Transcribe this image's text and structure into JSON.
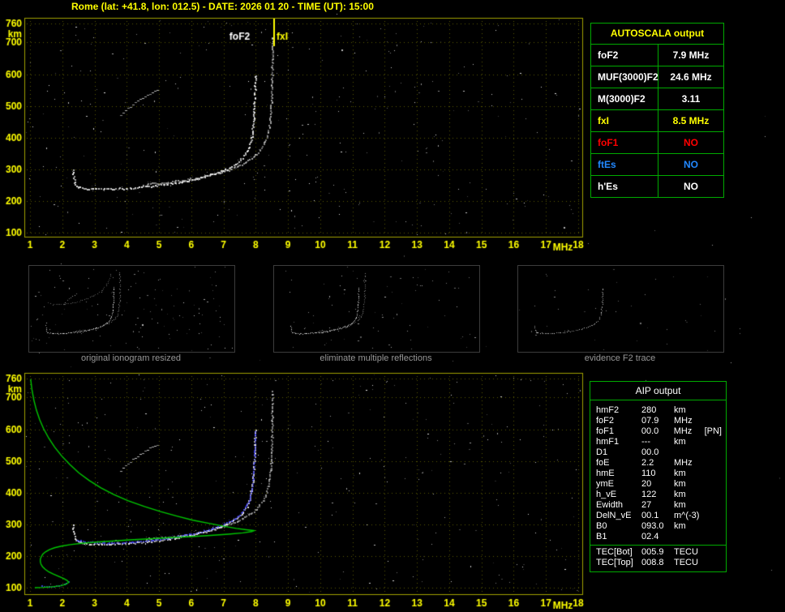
{
  "title": "Rome (lat: +41.8, lon: 012.5) - DATE: 2026 01 20 - TIME (UT): 15:00",
  "colors": {
    "axis_text": "#ffff00",
    "plot_border": "#a0a000",
    "grid": "#5a5a00",
    "trace": "#ffffff",
    "profile_green": "#00c800",
    "fit_blue": "#4646ff",
    "table_border": "#00aa00",
    "caption_gray": "#979797",
    "no_red": "#ff0000",
    "es_blue": "#2288ff"
  },
  "autoscala_table": {
    "header": "AUTOSCALA output",
    "rows": [
      {
        "param": "foF2",
        "value": "7.9 MHz",
        "color": "#ffffff"
      },
      {
        "param": "MUF(3000)F2",
        "value": "24.6 MHz",
        "color": "#ffffff"
      },
      {
        "param": "M(3000)F2",
        "value": "3.11",
        "color": "#ffffff"
      },
      {
        "param": "fxI",
        "value": "8.5 MHz",
        "color": "#ffff00"
      },
      {
        "param": "foF1",
        "value": "NO",
        "color": "#ff0000"
      },
      {
        "param": "ftEs",
        "value": "NO",
        "color": "#2288ff"
      },
      {
        "param": "h'Es",
        "value": "NO",
        "color": "#ffffff"
      }
    ]
  },
  "aip_table": {
    "header": "AIP output",
    "rows": [
      {
        "param": "hmF2",
        "value": "280",
        "unit": "km",
        "note": ""
      },
      {
        "param": "foF2",
        "value": "07.9",
        "unit": "MHz",
        "note": ""
      },
      {
        "param": "foF1",
        "value": "00.0",
        "unit": "MHz",
        "note": "[PN]"
      },
      {
        "param": "hmF1",
        "value": "---",
        "unit": "km",
        "note": ""
      },
      {
        "param": "D1",
        "value": "00.0",
        "unit": "",
        "note": ""
      },
      {
        "param": "foE",
        "value": "2.2",
        "unit": "MHz",
        "note": ""
      },
      {
        "param": "hmE",
        "value": "110",
        "unit": "km",
        "note": ""
      },
      {
        "param": "ymE",
        "value": "20",
        "unit": "km",
        "note": ""
      },
      {
        "param": "h_vE",
        "value": "122",
        "unit": "km",
        "note": ""
      },
      {
        "param": "Ewidth",
        "value": "27",
        "unit": "km",
        "note": ""
      },
      {
        "param": "DelN_vE",
        "value": "00.1",
        "unit": "m^(-3)",
        "note": ""
      },
      {
        "param": "B0",
        "value": "093.0",
        "unit": "km",
        "note": ""
      },
      {
        "param": "B1",
        "value": "02.4",
        "unit": "",
        "note": ""
      }
    ],
    "tec_rows": [
      {
        "param": "TEC[Bot]",
        "value": "005.9",
        "unit": "TECU"
      },
      {
        "param": "TEC[Top]",
        "value": "008.8",
        "unit": "TECU"
      }
    ]
  },
  "thumbnails": [
    {
      "caption": "original ionogram resized"
    },
    {
      "caption": "eliminate multiple reflections"
    },
    {
      "caption": "evidence F2 trace"
    }
  ],
  "chart_data": [
    {
      "type": "scatter",
      "name": "scaled ionogram",
      "xlabel": "MHz",
      "ylabel": "km",
      "xlim": [
        1,
        18
      ],
      "ylim": [
        100,
        760
      ],
      "x_ticks": [
        1,
        2,
        3,
        4,
        5,
        6,
        7,
        8,
        9,
        10,
        11,
        12,
        13,
        14,
        15,
        16,
        17,
        18
      ],
      "y_ticks": [
        760,
        700,
        600,
        500,
        400,
        300,
        200,
        100
      ],
      "grid": true,
      "annotations": [
        {
          "label": "foF2",
          "freq_mhz": 7.9,
          "label_x": 7.5,
          "color": "#ffffff",
          "draw_line": false,
          "line_x": null
        },
        {
          "label": "fxI",
          "freq_mhz": 8.5,
          "label_x": 8.82,
          "color": "#ffff00",
          "draw_line": true,
          "line_x": 8.55
        }
      ],
      "series": [
        {
          "name": "F2-O-trace",
          "color": "#ffffff",
          "render": "dots",
          "alpha": 0.92,
          "points": [
            [
              2.32,
              300
            ],
            [
              2.34,
              285
            ],
            [
              2.36,
              270
            ],
            [
              2.38,
              258
            ],
            [
              2.42,
              250
            ],
            [
              2.5,
              245
            ],
            [
              2.7,
              241
            ],
            [
              3.0,
              239
            ],
            [
              3.3,
              239
            ],
            [
              3.6,
              240
            ],
            [
              3.9,
              241
            ],
            [
              4.2,
              243
            ],
            [
              4.5,
              246
            ],
            [
              4.8,
              249
            ],
            [
              5.1,
              253
            ],
            [
              5.4,
              257
            ],
            [
              5.7,
              262
            ],
            [
              6.0,
              268
            ],
            [
              6.3,
              275
            ],
            [
              6.6,
              284
            ],
            [
              6.9,
              294
            ],
            [
              7.1,
              303
            ],
            [
              7.3,
              314
            ],
            [
              7.45,
              325
            ],
            [
              7.58,
              338
            ],
            [
              7.68,
              352
            ],
            [
              7.76,
              368
            ],
            [
              7.82,
              386
            ],
            [
              7.86,
              406
            ],
            [
              7.89,
              428
            ],
            [
              7.91,
              452
            ],
            [
              7.93,
              480
            ],
            [
              7.95,
              512
            ],
            [
              7.96,
              545
            ],
            [
              7.97,
              578
            ],
            [
              7.98,
              605
            ]
          ]
        },
        {
          "name": "F2-X-trace",
          "color": "#ffffff",
          "render": "dots",
          "alpha": 0.62,
          "points": [
            [
              4.6,
              255
            ],
            [
              5.0,
              258
            ],
            [
              5.4,
              262
            ],
            [
              5.8,
              268
            ],
            [
              6.2,
              275
            ],
            [
              6.6,
              284
            ],
            [
              7.0,
              295
            ],
            [
              7.3,
              306
            ],
            [
              7.6,
              320
            ],
            [
              7.85,
              336
            ],
            [
              8.05,
              354
            ],
            [
              8.2,
              374
            ],
            [
              8.3,
              396
            ],
            [
              8.37,
              420
            ],
            [
              8.42,
              448
            ],
            [
              8.45,
              480
            ],
            [
              8.47,
              515
            ],
            [
              8.48,
              552
            ],
            [
              8.49,
              592
            ],
            [
              8.5,
              635
            ],
            [
              8.5,
              680
            ],
            [
              8.5,
              725
            ]
          ]
        },
        {
          "name": "multiple-reflection-echo",
          "color": "#ffffff",
          "render": "dashes",
          "alpha": 0.8,
          "points": [
            [
              3.8,
              470
            ],
            [
              3.95,
              485
            ],
            [
              4.1,
              498
            ],
            [
              4.25,
              510
            ],
            [
              4.4,
              521
            ],
            [
              4.55,
              531
            ],
            [
              4.7,
              540
            ],
            [
              4.85,
              548
            ],
            [
              5.0,
              555
            ]
          ]
        }
      ]
    },
    {
      "type": "scatter",
      "name": "ionogram with restored trace and electron density profile",
      "xlabel": "MHz",
      "ylabel": "km",
      "xlim": [
        1,
        18
      ],
      "ylim": [
        100,
        760
      ],
      "x_ticks": [
        1,
        2,
        3,
        4,
        5,
        6,
        7,
        8,
        9,
        10,
        11,
        12,
        13,
        14,
        15,
        16,
        17,
        18
      ],
      "y_ticks": [
        760,
        700,
        600,
        500,
        400,
        300,
        200,
        100
      ],
      "grid": true,
      "include_series_from_chart": 0,
      "annotations": [],
      "series": [
        {
          "name": "restored-trace-F",
          "color": "#4646ff",
          "render": "dots",
          "alpha": 0.95,
          "points": [
            [
              2.45,
              252
            ],
            [
              2.7,
              246
            ],
            [
              3.0,
              243
            ],
            [
              3.3,
              242
            ],
            [
              3.6,
              243
            ],
            [
              3.9,
              244
            ],
            [
              4.2,
              246
            ],
            [
              4.5,
              249
            ],
            [
              4.8,
              252
            ],
            [
              5.1,
              256
            ],
            [
              5.4,
              260
            ],
            [
              5.7,
              265
            ],
            [
              6.0,
              271
            ],
            [
              6.3,
              278
            ],
            [
              6.6,
              287
            ],
            [
              6.9,
              297
            ],
            [
              7.1,
              306
            ],
            [
              7.3,
              317
            ],
            [
              7.45,
              328
            ],
            [
              7.58,
              341
            ],
            [
              7.68,
              355
            ],
            [
              7.76,
              371
            ],
            [
              7.82,
              389
            ],
            [
              7.86,
              409
            ],
            [
              7.89,
              431
            ],
            [
              7.91,
              455
            ],
            [
              7.93,
              483
            ],
            [
              7.95,
              515
            ],
            [
              7.96,
              548
            ],
            [
              7.97,
              580
            ],
            [
              7.98,
              600
            ]
          ]
        },
        {
          "name": "restored-trace-E",
          "color": "#4646ff",
          "render": "dots",
          "alpha": 0.95,
          "points": [
            [
              1.35,
              106
            ],
            [
              1.5,
              105
            ],
            [
              1.65,
              105
            ],
            [
              1.8,
              106
            ],
            [
              1.95,
              108
            ],
            [
              2.05,
              111
            ],
            [
              2.12,
              115
            ],
            [
              2.17,
              121
            ],
            [
              2.2,
              128
            ]
          ]
        },
        {
          "name": "electron-density-profile",
          "color": "#00c800",
          "render": "line",
          "alpha": 1.0,
          "points": [
            [
              1.02,
              758
            ],
            [
              1.06,
              725
            ],
            [
              1.12,
              692
            ],
            [
              1.2,
              660
            ],
            [
              1.3,
              630
            ],
            [
              1.42,
              602
            ],
            [
              1.58,
              572
            ],
            [
              1.76,
              544
            ],
            [
              1.98,
              516
            ],
            [
              2.24,
              488
            ],
            [
              2.52,
              462
            ],
            [
              2.84,
              438
            ],
            [
              3.2,
              415
            ],
            [
              3.6,
              394
            ],
            [
              4.05,
              374
            ],
            [
              4.55,
              356
            ],
            [
              5.05,
              340
            ],
            [
              5.55,
              326
            ],
            [
              6.05,
              313
            ],
            [
              6.55,
              303
            ],
            [
              7.0,
              294
            ],
            [
              7.4,
              287
            ],
            [
              7.7,
              283
            ],
            [
              7.88,
              281
            ],
            [
              7.95,
              280
            ],
            [
              7.88,
              277
            ],
            [
              7.6,
              273
            ],
            [
              7.15,
              269
            ],
            [
              6.6,
              265
            ],
            [
              6.0,
              261
            ],
            [
              5.35,
              258
            ],
            [
              4.7,
              254
            ],
            [
              4.1,
              251
            ],
            [
              3.55,
              247
            ],
            [
              3.05,
              244
            ],
            [
              2.6,
              240
            ],
            [
              2.25,
              236
            ],
            [
              1.97,
              231
            ],
            [
              1.76,
              226
            ],
            [
              1.6,
              220
            ],
            [
              1.48,
              213
            ],
            [
              1.4,
              206
            ],
            [
              1.35,
              198
            ],
            [
              1.32,
              190
            ],
            [
              1.32,
              182
            ],
            [
              1.34,
              174
            ],
            [
              1.39,
              166
            ],
            [
              1.47,
              158
            ],
            [
              1.58,
              150
            ],
            [
              1.72,
              143
            ],
            [
              1.88,
              136
            ],
            [
              2.04,
              129
            ],
            [
              2.15,
              123
            ],
            [
              2.2,
              117
            ],
            [
              2.12,
              111
            ],
            [
              1.95,
              106
            ],
            [
              1.7,
              103
            ],
            [
              1.42,
              101
            ],
            [
              1.15,
              100
            ]
          ]
        }
      ]
    }
  ]
}
